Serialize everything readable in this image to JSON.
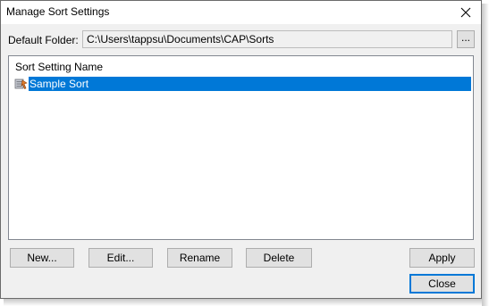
{
  "window": {
    "title": "Manage Sort Settings",
    "close_glyph": "×"
  },
  "folder": {
    "label": "Default Folder:",
    "value": "C:\\Users\\tappsu\\Documents\\CAP\\Sorts",
    "browse_label": "..."
  },
  "list": {
    "header": "Sort Setting Name",
    "items": [
      {
        "label": "Sample Sort",
        "icon": "sort-setting-icon",
        "selected": true
      }
    ]
  },
  "buttons": {
    "new": "New...",
    "edit": "Edit...",
    "rename": "Rename",
    "delete": "Delete",
    "apply": "Apply",
    "close": "Close"
  },
  "colors": {
    "selection": "#0078d7",
    "window_bg": "#f0f0f0"
  }
}
